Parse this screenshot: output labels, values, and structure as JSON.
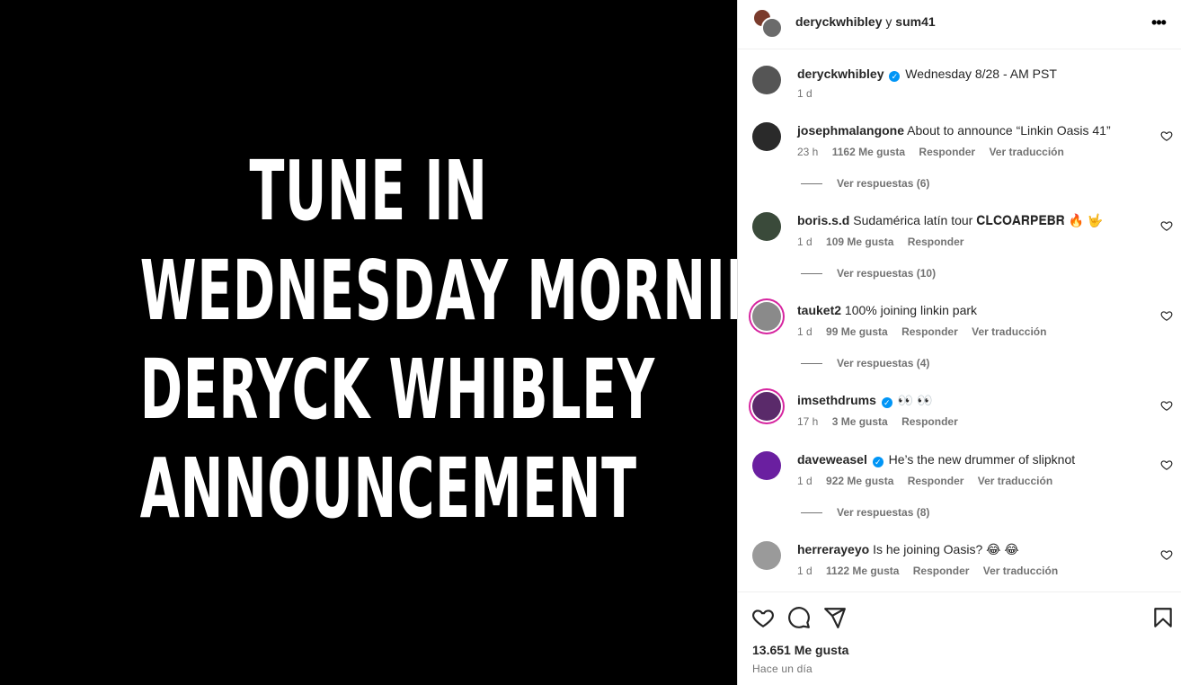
{
  "media": {
    "lines": [
      "TUNE IN",
      "WEDNESDAY MORNING",
      "DERYCK WHIBLEY",
      "ANNOUNCEMENT"
    ]
  },
  "header": {
    "username": "deryckwhibley",
    "conjunction": "y",
    "collaborator": "sum41",
    "more_icon": "more-horizontal-icon"
  },
  "caption": {
    "username": "deryckwhibley",
    "verified": true,
    "text": "Wednesday 8/28 - AM PST",
    "time": "1 d"
  },
  "comments": [
    {
      "username": "josephmalangone",
      "verified": false,
      "text": "About to announce “Linkin Oasis 41”",
      "time": "23 h",
      "likes": "1162 Me gusta",
      "reply": "Responder",
      "translate": "Ver traducción",
      "replies": "Ver respuestas (6)",
      "avatar_color": "#2a2a2a"
    },
    {
      "username": "boris.s.d",
      "verified": false,
      "text": "Sudamérica latín tour 𝐂𝐋𝐂𝐎𝐀𝐑𝐏𝐄𝐁𝐑 🔥 🤟",
      "time": "1 d",
      "likes": "109 Me gusta",
      "reply": "Responder",
      "translate": "",
      "replies": "Ver respuestas (10)",
      "avatar_color": "#3a4a3a"
    },
    {
      "username": "tauket2",
      "verified": false,
      "text": "100% joining linkin park",
      "time": "1 d",
      "likes": "99 Me gusta",
      "reply": "Responder",
      "translate": "Ver traducción",
      "replies": "Ver respuestas (4)",
      "avatar_color": "#8a8a8a"
    },
    {
      "username": "imsethdrums",
      "verified": true,
      "text": "👀 👀",
      "time": "17 h",
      "likes": "3 Me gusta",
      "reply": "Responder",
      "translate": "",
      "replies": "",
      "avatar_color": "#5a2a6a"
    },
    {
      "username": "daveweasel",
      "verified": true,
      "text": "He’s the new drummer of slipknot",
      "time": "1 d",
      "likes": "922 Me gusta",
      "reply": "Responder",
      "translate": "Ver traducción",
      "replies": "Ver respuestas (8)",
      "avatar_color": "#6a1fa0"
    },
    {
      "username": "herrerayeyo",
      "verified": false,
      "text": "Is he joining Oasis? 😂 😂",
      "time": "1 d",
      "likes": "1122 Me gusta",
      "reply": "Responder",
      "translate": "Ver traducción",
      "replies": "",
      "avatar_color": "#9a9a9a"
    }
  ],
  "footer": {
    "like_count": "13.651 Me gusta",
    "posted": "Hace un día",
    "icons": [
      "heart-icon",
      "comment-icon",
      "share-icon",
      "bookmark-icon"
    ]
  },
  "colors": {
    "verified": "#0095f6",
    "muted": "#737373",
    "text": "#262626",
    "story_ring": "#d6249f"
  }
}
